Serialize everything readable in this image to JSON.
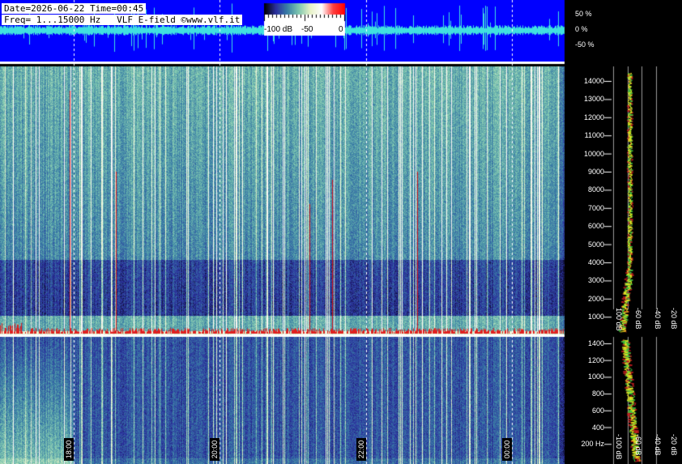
{
  "header": {
    "date_line": "Date=2026-06-22 Time=00:45",
    "freq_line": "Freq= 1...15000 Hz   VLF E-field ©www.vlf.it"
  },
  "colorbar": {
    "labels": [
      "-100 dB",
      "-50",
      "0"
    ],
    "colors": [
      "#000000",
      "#2b2f9e",
      "#3a7fa6",
      "#7fc8b0",
      "#e8f2c8",
      "#ffffff",
      "#ff4040",
      "#ff0000"
    ]
  },
  "waveform": {
    "labels": [
      "50 %",
      "0 %",
      "-50 %"
    ],
    "background": "#0000ff",
    "trace_color": "#40e0e0"
  },
  "chart_data": [
    {
      "type": "heatmap",
      "name": "spectrogram-upper",
      "y_ticks": [
        "14000",
        "13000",
        "12000",
        "11000",
        "10000",
        "9000",
        "8000",
        "7000",
        "6000",
        "5000",
        "4000",
        "3000",
        "2000",
        "1000"
      ],
      "ylim": [
        0,
        15000
      ],
      "x_ticks": [
        "18:00",
        "20:00",
        "22:00",
        "00:00"
      ]
    },
    {
      "type": "heatmap",
      "name": "spectrogram-lower",
      "y_ticks": [
        "1400",
        "1200",
        "1000",
        "800",
        "600",
        "400",
        "200 Hz"
      ],
      "ylim": [
        0,
        1500
      ],
      "x_ticks": [
        "18:00",
        "20:00",
        "22:00",
        "00:00"
      ]
    },
    {
      "type": "line",
      "name": "spectrum-profile-upper",
      "x_ticks": [
        "100 dB",
        "-60 dB",
        "-40 dB",
        "-20 dB"
      ]
    },
    {
      "type": "line",
      "name": "spectrum-profile-lower",
      "x_ticks": [
        "-100 dB",
        "-60 dB",
        "-40 dB",
        "-20 dB"
      ]
    }
  ]
}
